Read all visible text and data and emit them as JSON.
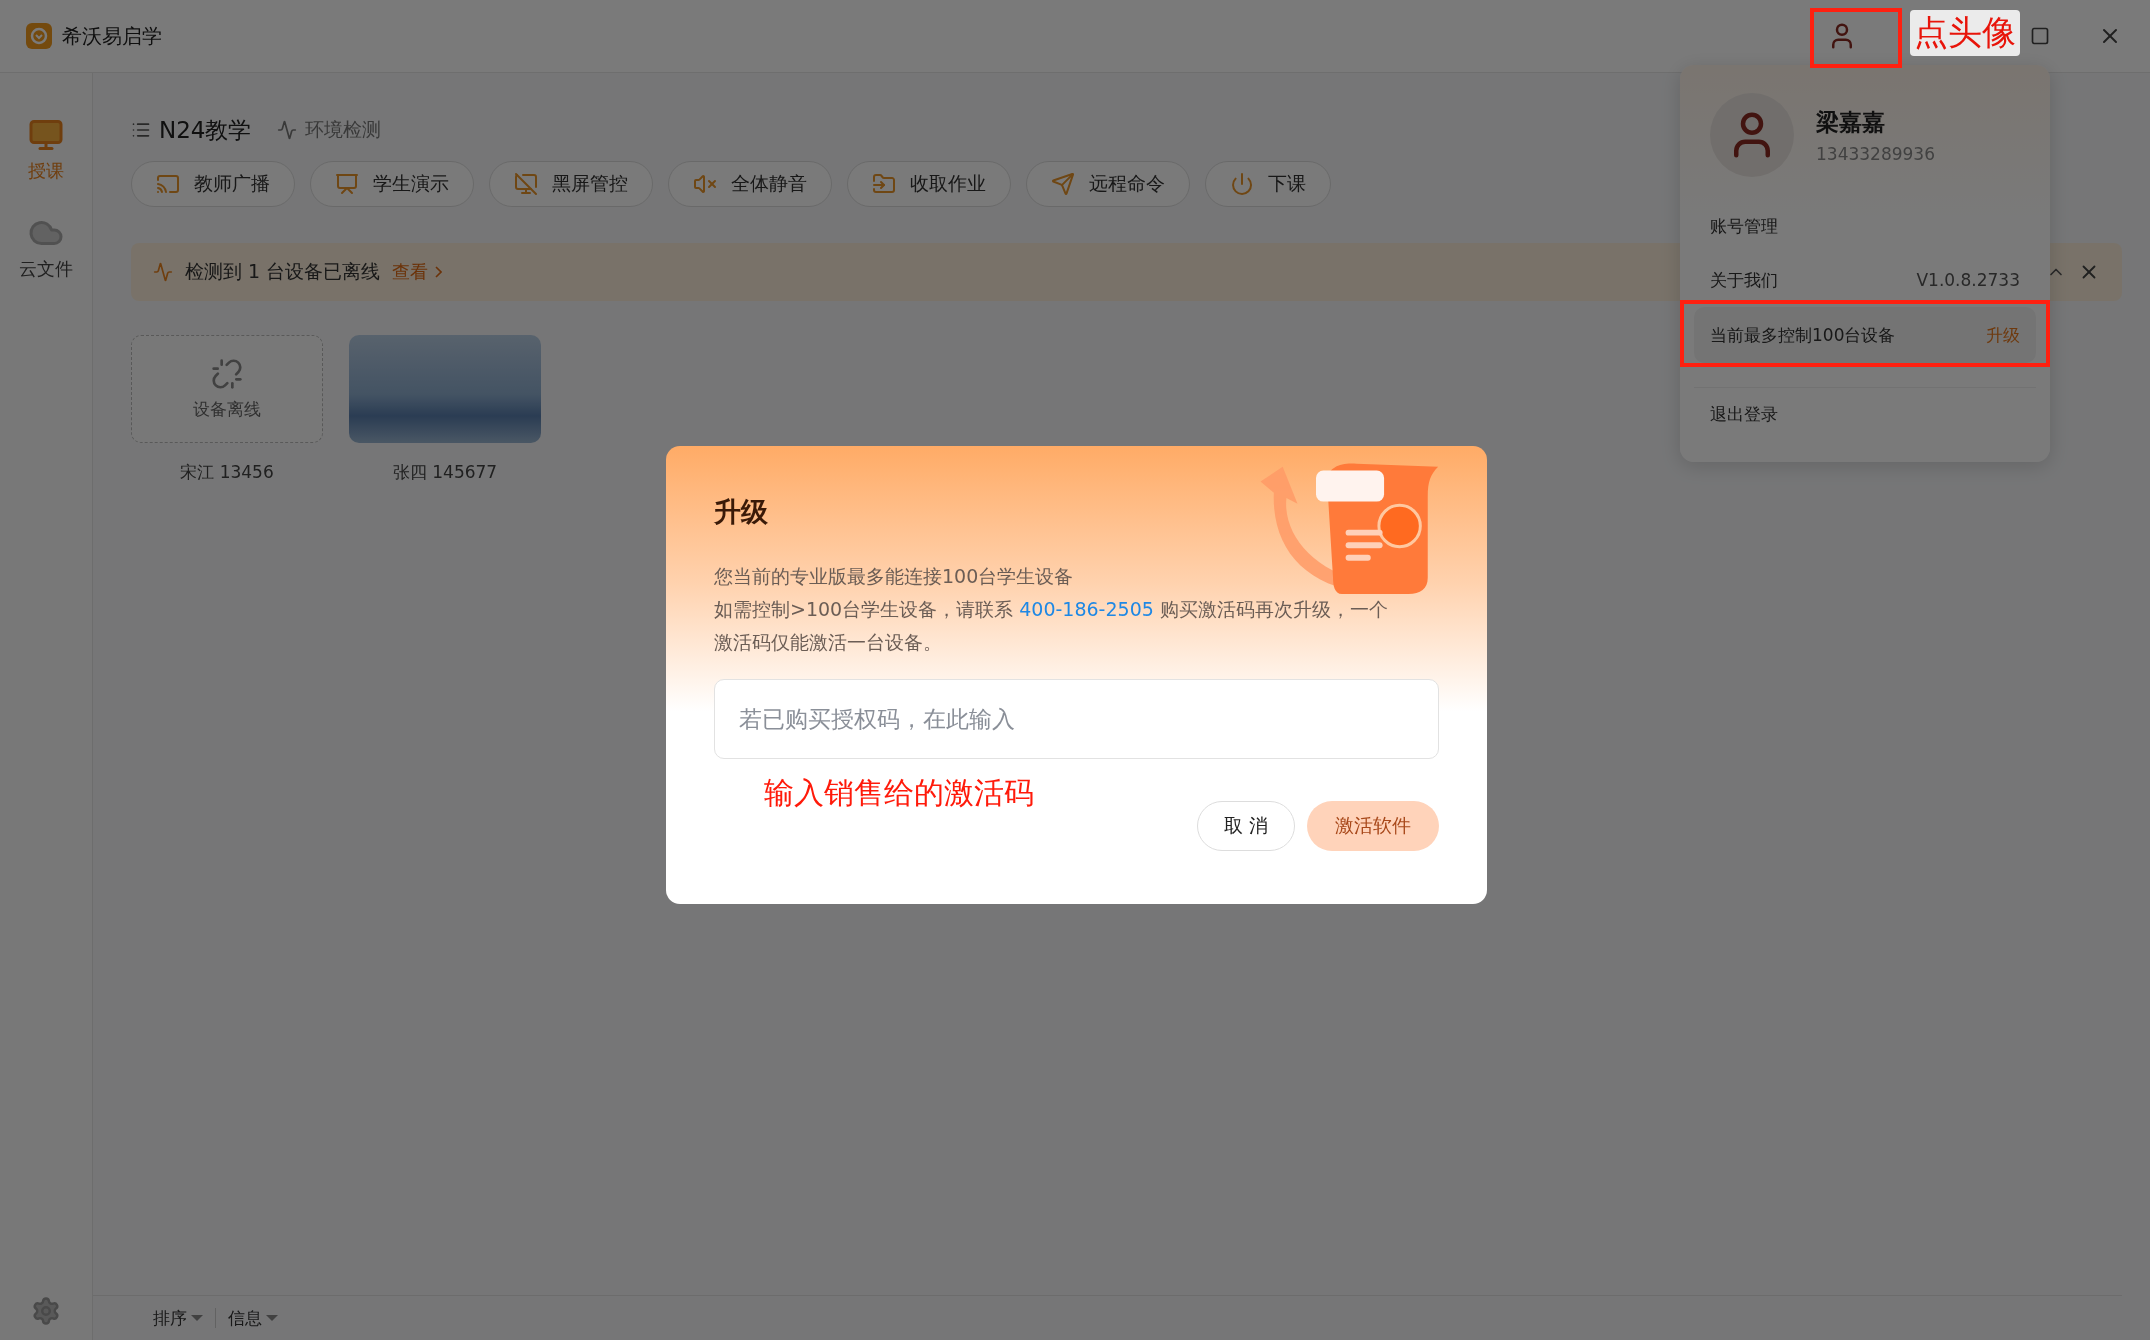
{
  "app": {
    "title": "希沃易启学"
  },
  "sidebar": {
    "items": [
      {
        "label": "授课",
        "selected": true
      },
      {
        "label": "云文件",
        "selected": false
      }
    ]
  },
  "class_header": {
    "title": "N24教学",
    "env_check": "环境检测"
  },
  "toolbar": [
    {
      "label": "教师广播"
    },
    {
      "label": "学生演示"
    },
    {
      "label": "黑屏管控"
    },
    {
      "label": "全体静音"
    },
    {
      "label": "收取作业"
    },
    {
      "label": "远程命令"
    },
    {
      "label": "下课"
    }
  ],
  "banner": {
    "message": "检测到 1 台设备已离线",
    "link": "查看"
  },
  "devices": [
    {
      "kind": "offline",
      "status": "设备离线",
      "name": "宋江 13456"
    },
    {
      "kind": "online",
      "name": "张四 145677"
    }
  ],
  "bottom_bar": {
    "sort": "排序",
    "info": "信息"
  },
  "account_menu": {
    "name": "梁嘉嘉",
    "phone": "13433289936",
    "items": [
      {
        "kind": "link",
        "label": "账号管理"
      },
      {
        "kind": "version",
        "label": "关于我们",
        "value": "V1.0.8.2733"
      },
      {
        "kind": "upgrade",
        "label": "当前最多控制100台设备",
        "action": "升级"
      },
      {
        "kind": "logout",
        "label": "退出登录"
      }
    ]
  },
  "dialog": {
    "title": "升级",
    "line1": "您当前的专业版最多能连接100台学生设备",
    "line2_before": "如需控制>100台学生设备，请联系 ",
    "phone": "400-186-2505",
    "line2_after": " 购买激活码再次升级，一个激活码仅能激活一台设备。",
    "placeholder": "若已购买授权码，在此输入",
    "buttons": [
      {
        "label": "取 消",
        "kind": "secondary",
        "disabled": false
      },
      {
        "label": "激活软件",
        "kind": "primary",
        "disabled": true
      }
    ]
  },
  "annotations": {
    "avatar_hint": "点头像",
    "input_hint": "输入销售给的激活码"
  }
}
